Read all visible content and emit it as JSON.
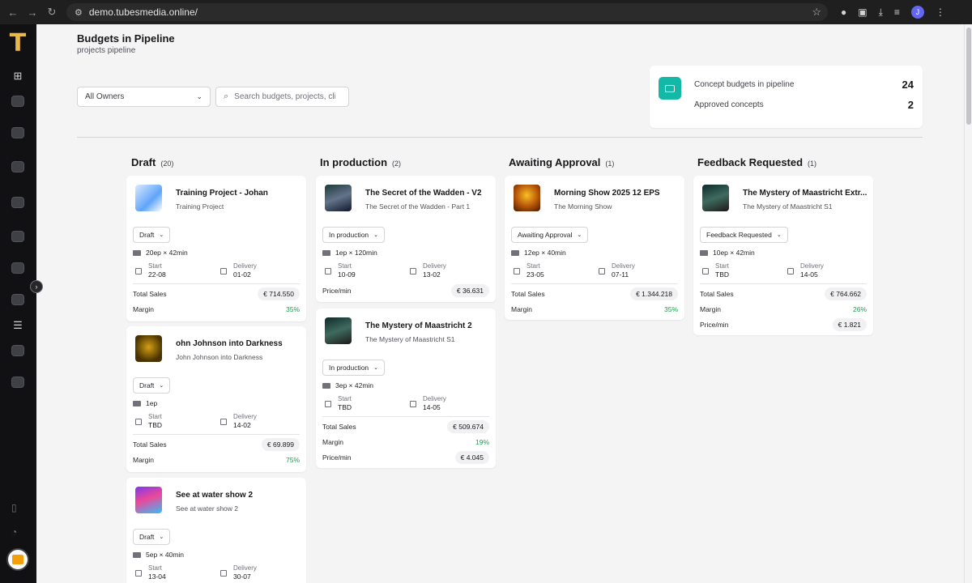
{
  "browser": {
    "url": "demo.tubesmedia.online/",
    "profile_initial": "J"
  },
  "app": {
    "logo_letter": "T"
  },
  "page": {
    "title": "Budgets in Pipeline",
    "subtitle": "projects pipeline"
  },
  "filters": {
    "owner_value": "All Owners",
    "search_placeholder": "Search budgets, projects, clie"
  },
  "summary": {
    "concept_label": "Concept budgets in pipeline",
    "concept_count": "24",
    "approved_label": "Approved concepts",
    "approved_count": "2",
    "icon_color": "#14b8a6"
  },
  "labels": {
    "start": "Start",
    "delivery": "Delivery",
    "total_sales": "Total Sales",
    "margin": "Margin",
    "price_min": "Price/min"
  },
  "columns": [
    {
      "title": "Draft",
      "count": "(20)",
      "cards": [
        {
          "title": "Training Project - Johan",
          "subtitle": "Training Project",
          "status": "Draft",
          "episodes": "20ep × 42min",
          "start": "22-08",
          "delivery": "01-02",
          "total_sales": "€ 714.550",
          "margin": "35%",
          "thumb_icon": "training-thumbnail"
        },
        {
          "title": "ohn Johnson into Darkness",
          "subtitle": "John Johnson into Darkness",
          "status": "Draft",
          "episodes": "1ep",
          "start": "TBD",
          "delivery": "14-02",
          "total_sales": "€ 69.899",
          "margin": "75%",
          "thumb_icon": "darkness-thumbnail"
        },
        {
          "title": "See at water show 2",
          "subtitle": "See at water show 2",
          "status": "Draft",
          "episodes": "5ep × 40min",
          "start": "13-04",
          "delivery": "30-07",
          "thumb_icon": "water-show-thumbnail"
        }
      ]
    },
    {
      "title": "In production",
      "count": "(2)",
      "cards": [
        {
          "title": "The Secret of the Wadden - V2",
          "subtitle": "The Secret of the Wadden - Part 1",
          "status": "In production",
          "episodes": "1ep × 120min",
          "start": "10-09",
          "delivery": "13-02",
          "price_min": "€ 36.631",
          "thumb_icon": "wadden-thumbnail"
        },
        {
          "title": "The Mystery of Maastricht 2",
          "subtitle": "The Mystery of Maastricht S1",
          "status": "In production",
          "episodes": "3ep × 42min",
          "start": "TBD",
          "delivery": "14-05",
          "total_sales": "€ 509.674",
          "margin": "19%",
          "price_min": "€ 4.045",
          "thumb_icon": "maastricht-thumbnail"
        }
      ]
    },
    {
      "title": "Awaiting Approval",
      "count": "(1)",
      "cards": [
        {
          "title": "Morning Show 2025 12 EPS",
          "subtitle": "The Morning Show",
          "status": "Awaiting Approval",
          "episodes": "12ep × 40min",
          "start": "23-05",
          "delivery": "07-11",
          "total_sales": "€ 1.344.218",
          "margin": "35%",
          "thumb_icon": "morning-show-thumbnail"
        }
      ]
    },
    {
      "title": "Feedback Requested",
      "count": "(1)",
      "cards": [
        {
          "title": "The Mystery of Maastricht Extr...",
          "subtitle": "The Mystery of Maastricht S1",
          "status": "Feedback Requested",
          "episodes": "10ep × 42min",
          "start": "TBD",
          "delivery": "14-05",
          "total_sales": "€ 764.662",
          "margin": "26%",
          "price_min": "€ 1.821",
          "thumb_icon": "maastricht-thumbnail"
        }
      ]
    }
  ]
}
